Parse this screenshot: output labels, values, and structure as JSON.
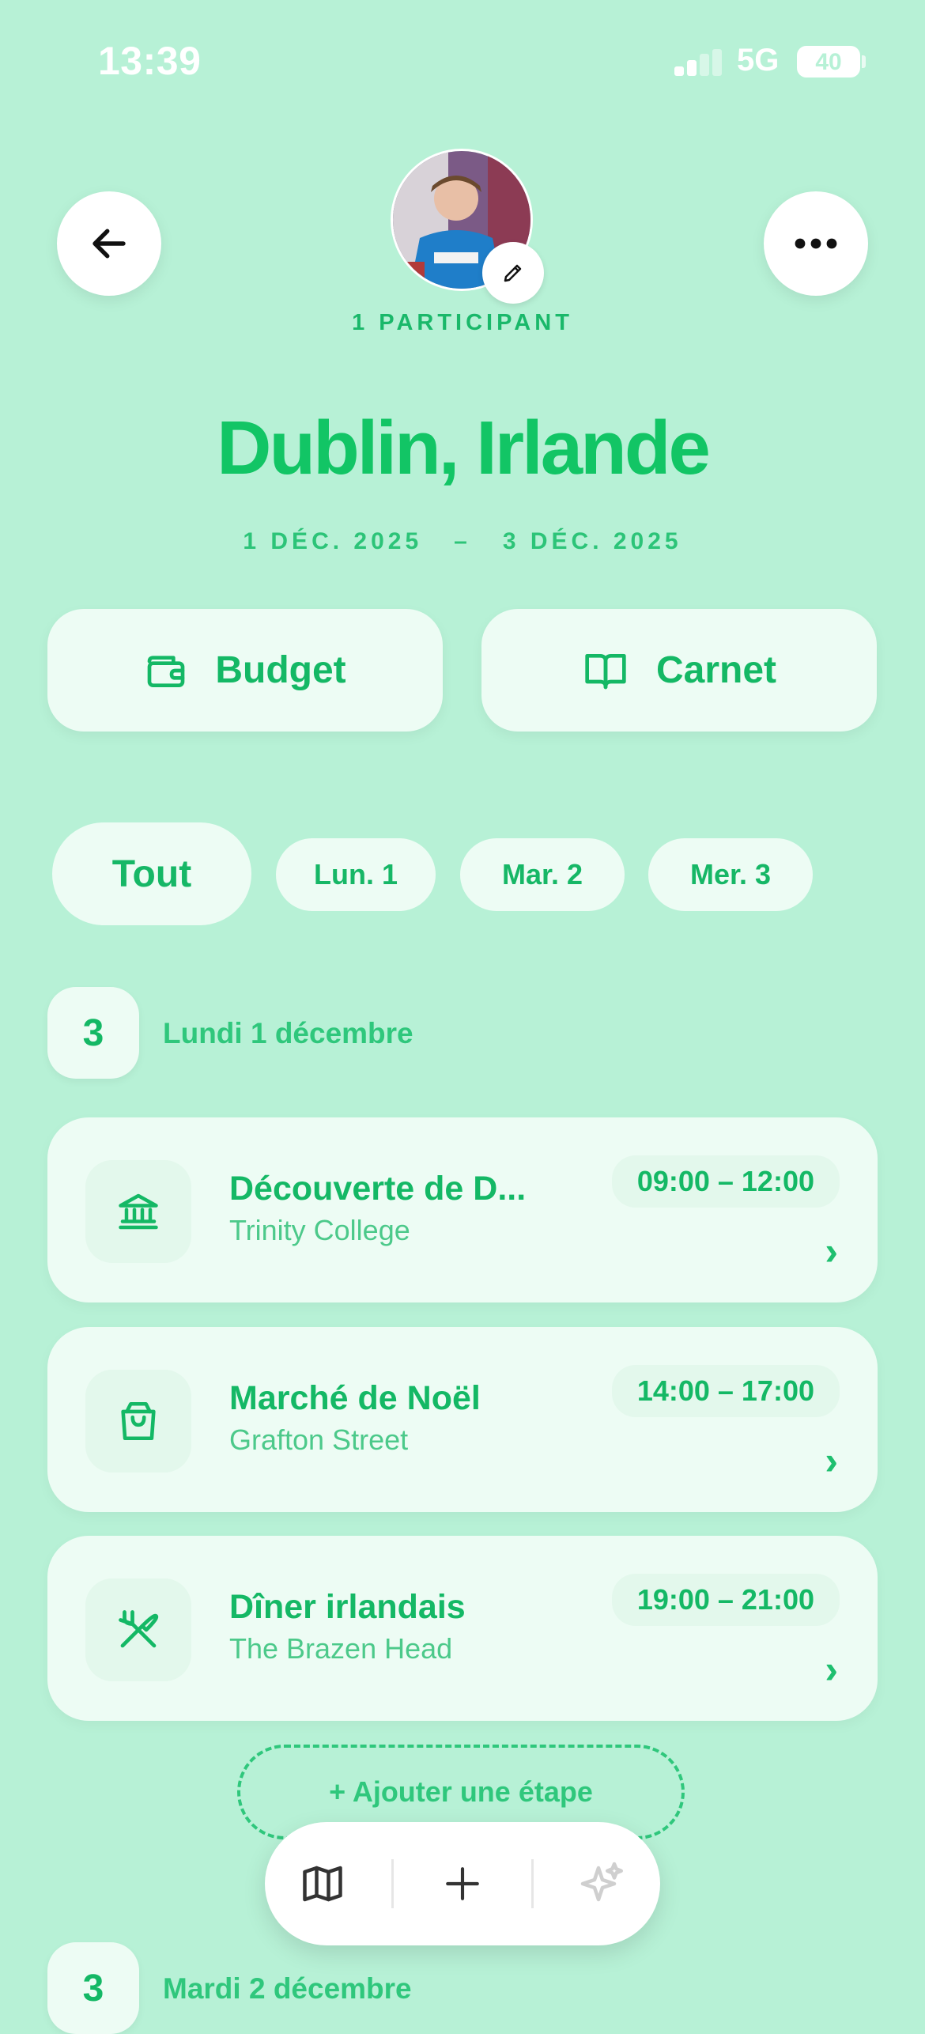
{
  "status": {
    "time": "13:39",
    "network": "5G",
    "battery": "40"
  },
  "header": {
    "participants": "1 PARTICIPANT",
    "title": "Dublin, Irlande",
    "date_start": "1 DÉC. 2025",
    "date_sep": "–",
    "date_end": "3 DÉC. 2025"
  },
  "actions": {
    "budget": "Budget",
    "carnet": "Carnet"
  },
  "filters": [
    {
      "label": "Tout",
      "selected": true
    },
    {
      "label": "Lun. 1",
      "selected": false
    },
    {
      "label": "Mar. 2",
      "selected": false
    },
    {
      "label": "Mer. 3",
      "selected": false
    }
  ],
  "days": [
    {
      "count": "3",
      "label": "Lundi 1 décembre",
      "items": [
        {
          "title": "Découverte de D...",
          "place": "Trinity College",
          "time": "09:00 – 12:00",
          "icon": "museum-icon"
        },
        {
          "title": "Marché de Noël",
          "place": "Grafton Street",
          "time": "14:00 – 17:00",
          "icon": "shopping-bag-icon"
        },
        {
          "title": "Dîner irlandais",
          "place": "The Brazen Head",
          "time": "19:00 – 21:00",
          "icon": "utensils-icon"
        }
      ],
      "add_label": "+ Ajouter une étape"
    },
    {
      "count": "3",
      "label": "Mardi 2 décembre"
    }
  ],
  "toolbar": {
    "items": [
      "map-icon",
      "plus-icon",
      "sparkles-icon"
    ]
  },
  "colors": {
    "background": "#b7f1d6",
    "accent": "#14c46a",
    "card": "#edfcf4"
  }
}
